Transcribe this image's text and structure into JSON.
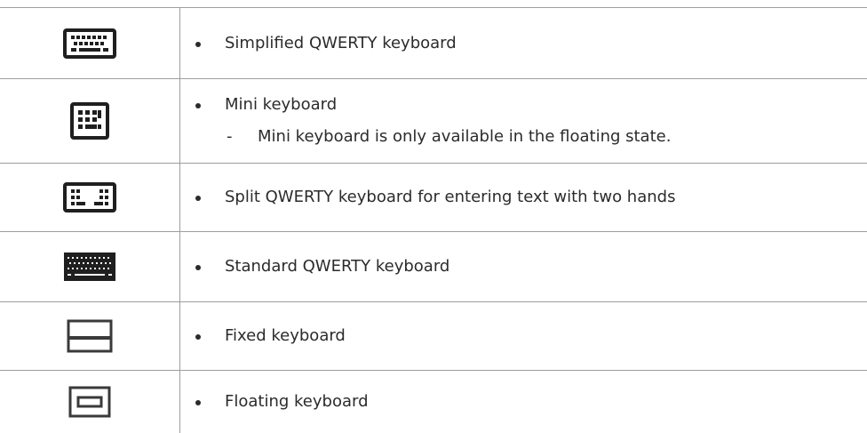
{
  "rows": [
    {
      "icon": "simplified-qwerty-keyboard-icon",
      "text": "Simplified QWERTY keyboard"
    },
    {
      "icon": "mini-keyboard-icon",
      "text": "Mini keyboard",
      "sub": "Mini keyboard is only available in the floating state."
    },
    {
      "icon": "split-keyboard-icon",
      "text": "Split QWERTY keyboard for entering text with two hands"
    },
    {
      "icon": "standard-qwerty-keyboard-icon",
      "text": "Standard QWERTY keyboard"
    },
    {
      "icon": "fixed-keyboard-icon",
      "text": "Fixed keyboard"
    },
    {
      "icon": "floating-keyboard-icon",
      "text": "Floating keyboard"
    }
  ],
  "colors": {
    "text": "#2b2b2b",
    "icon": "#1f1f1f",
    "border": "#9e9e9e"
  }
}
